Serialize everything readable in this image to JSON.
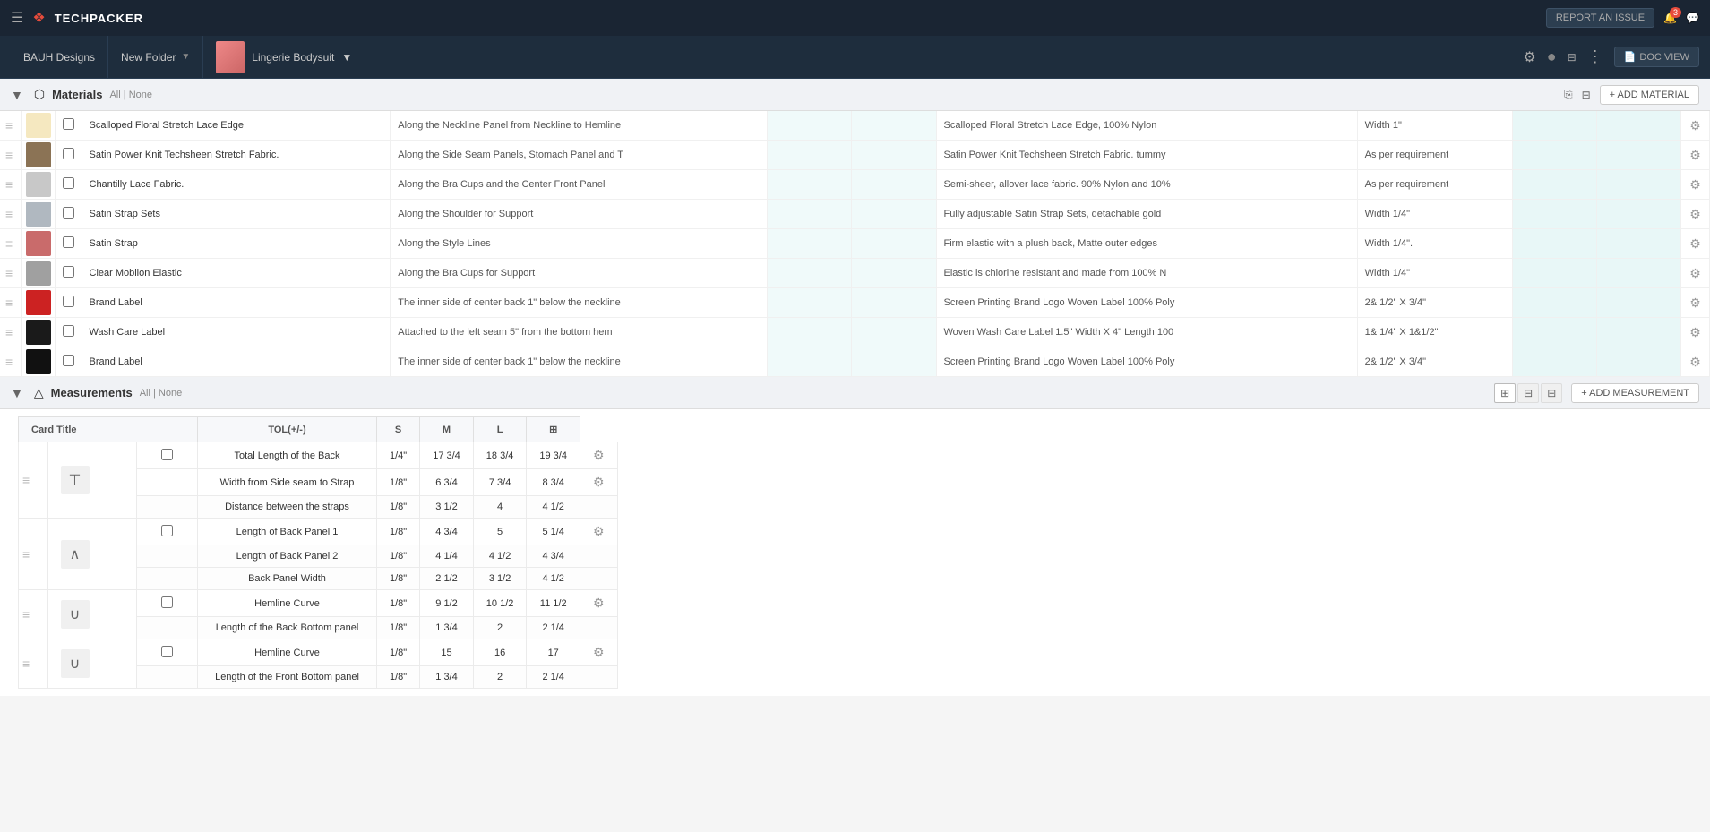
{
  "app": {
    "logo": "❖",
    "name": "TECHPACKER",
    "hamburger": "☰",
    "report_issue": "REPORT AN ISSUE",
    "notification_count": "3"
  },
  "nav": {
    "company": "BAUH Designs",
    "folder": "New Folder",
    "product_name": "Lingerie Bodysuit",
    "settings_icon": "⚙",
    "toggle": "○",
    "filter_icon": "⊟",
    "more_icon": "⋮",
    "doc_view": "DOC VIEW"
  },
  "materials": {
    "section_title": "Materials",
    "all_label": "All",
    "none_label": "None",
    "add_label": "+ ADD MATERIAL",
    "rows": [
      {
        "name": "Scalloped Floral Stretch Lace Edge",
        "placement": "Along the Neckline Panel from Neckline to Hemline",
        "description": "Scalloped Floral Stretch Lace Edge, 100% Nylon",
        "size": "Width 1\"",
        "swatch_color": "#f5e8c0"
      },
      {
        "name": "Satin Power Knit Techsheen Stretch Fabric.",
        "placement": "Along the Side Seam Panels, Stomach Panel and T",
        "description": "Satin Power Knit Techsheen Stretch Fabric. tummy",
        "size": "As per requirement",
        "swatch_color": "#8b7355"
      },
      {
        "name": "Chantilly Lace Fabric.",
        "placement": "Along the Bra Cups and the Center Front Panel",
        "description": "Semi-sheer, allover lace fabric. 90% Nylon and 10%",
        "size": "As per requirement",
        "swatch_color": "#c8c8c8"
      },
      {
        "name": "Satin Strap Sets",
        "placement": "Along the Shoulder for Support",
        "description": "Fully adjustable Satin Strap Sets, detachable gold",
        "size": "Width 1/4\"",
        "swatch_color": "#b0b8c0"
      },
      {
        "name": "Satin Strap",
        "placement": "Along the Style Lines",
        "description": "Firm elastic with a plush back, Matte outer edges",
        "size": "Width 1/4\".",
        "swatch_color": "#c96b6b"
      },
      {
        "name": "Clear Mobilon Elastic",
        "placement": "Along the Bra Cups for Support",
        "description": "Elastic is chlorine resistant and made from 100% N",
        "size": "Width 1/4\"",
        "swatch_color": "#a0a0a0"
      },
      {
        "name": "Brand Label",
        "placement": "The inner side of center back 1\" below the neckline",
        "description": "Screen Printing Brand Logo Woven Label 100% Poly",
        "size": "2& 1/2\"  X 3/4\"",
        "swatch_color": "#cc2222"
      },
      {
        "name": "Wash Care Label",
        "placement": "Attached to the left seam 5\" from the bottom hem",
        "description": "Woven Wash Care Label 1.5\" Width X 4\" Length 100",
        "size": "1& 1/4\" X 1&1/2\"",
        "swatch_color": "#1a1a1a"
      },
      {
        "name": "Brand Label",
        "placement": "The inner side of center back 1\" below the neckline",
        "description": "Screen Printing Brand Logo Woven Label 100% Poly",
        "size": "2& 1/2\"  X 3/4\"",
        "swatch_color": "#111111"
      }
    ]
  },
  "measurements": {
    "section_title": "Measurements",
    "all_label": "All",
    "none_label": "None",
    "add_label": "+ ADD MEASUREMENT",
    "col_card": "Card Title",
    "col_tol": "TOL(+/-)",
    "col_s": "S",
    "col_m": "M",
    "col_l": "L",
    "groups": [
      {
        "icon": "⊤",
        "rows": [
          {
            "label": "Total Length of the Back",
            "tol": "1/4\"",
            "s": "17 3/4",
            "m": "18 3/4",
            "l": "19 3/4",
            "has_gear": true,
            "is_main": true
          },
          {
            "label": "Width from Side seam to Strap",
            "tol": "1/8\"",
            "s": "6 3/4",
            "m": "7 3/4",
            "l": "8 3/4",
            "has_gear": true,
            "is_main": true
          },
          {
            "label": "Distance between the straps",
            "tol": "1/8\"",
            "s": "3 1/2",
            "m": "4",
            "l": "4 1/2",
            "has_gear": false,
            "is_main": false
          }
        ]
      },
      {
        "icon": "∧",
        "rows": [
          {
            "label": "Length of Back Panel 1",
            "tol": "1/8\"",
            "s": "4 3/4",
            "m": "5",
            "l": "5 1/4",
            "has_gear": true,
            "is_main": true
          },
          {
            "label": "Length of Back Panel 2",
            "tol": "1/8\"",
            "s": "4 1/4",
            "m": "4 1/2",
            "l": "4 3/4",
            "has_gear": false,
            "is_main": false
          },
          {
            "label": "Back Panel Width",
            "tol": "1/8\"",
            "s": "2 1/2",
            "m": "3 1/2",
            "l": "4 1/2",
            "has_gear": false,
            "is_main": false
          }
        ]
      },
      {
        "icon": "∪",
        "rows": [
          {
            "label": "Hemline Curve",
            "tol": "1/8\"",
            "s": "9 1/2",
            "m": "10 1/2",
            "l": "11 1/2",
            "has_gear": true,
            "is_main": true
          },
          {
            "label": "Length of the Back Bottom panel",
            "tol": "1/8\"",
            "s": "1 3/4",
            "m": "2",
            "l": "2 1/4",
            "has_gear": false,
            "is_main": false
          }
        ]
      },
      {
        "icon": "∪",
        "rows": [
          {
            "label": "Hemline Curve",
            "tol": "1/8\"",
            "s": "15",
            "m": "16",
            "l": "17",
            "has_gear": true,
            "is_main": true
          },
          {
            "label": "Length of the Front Bottom panel",
            "tol": "1/8\"",
            "s": "1 3/4",
            "m": "2",
            "l": "2 1/4",
            "has_gear": false,
            "is_main": false
          }
        ]
      }
    ]
  }
}
